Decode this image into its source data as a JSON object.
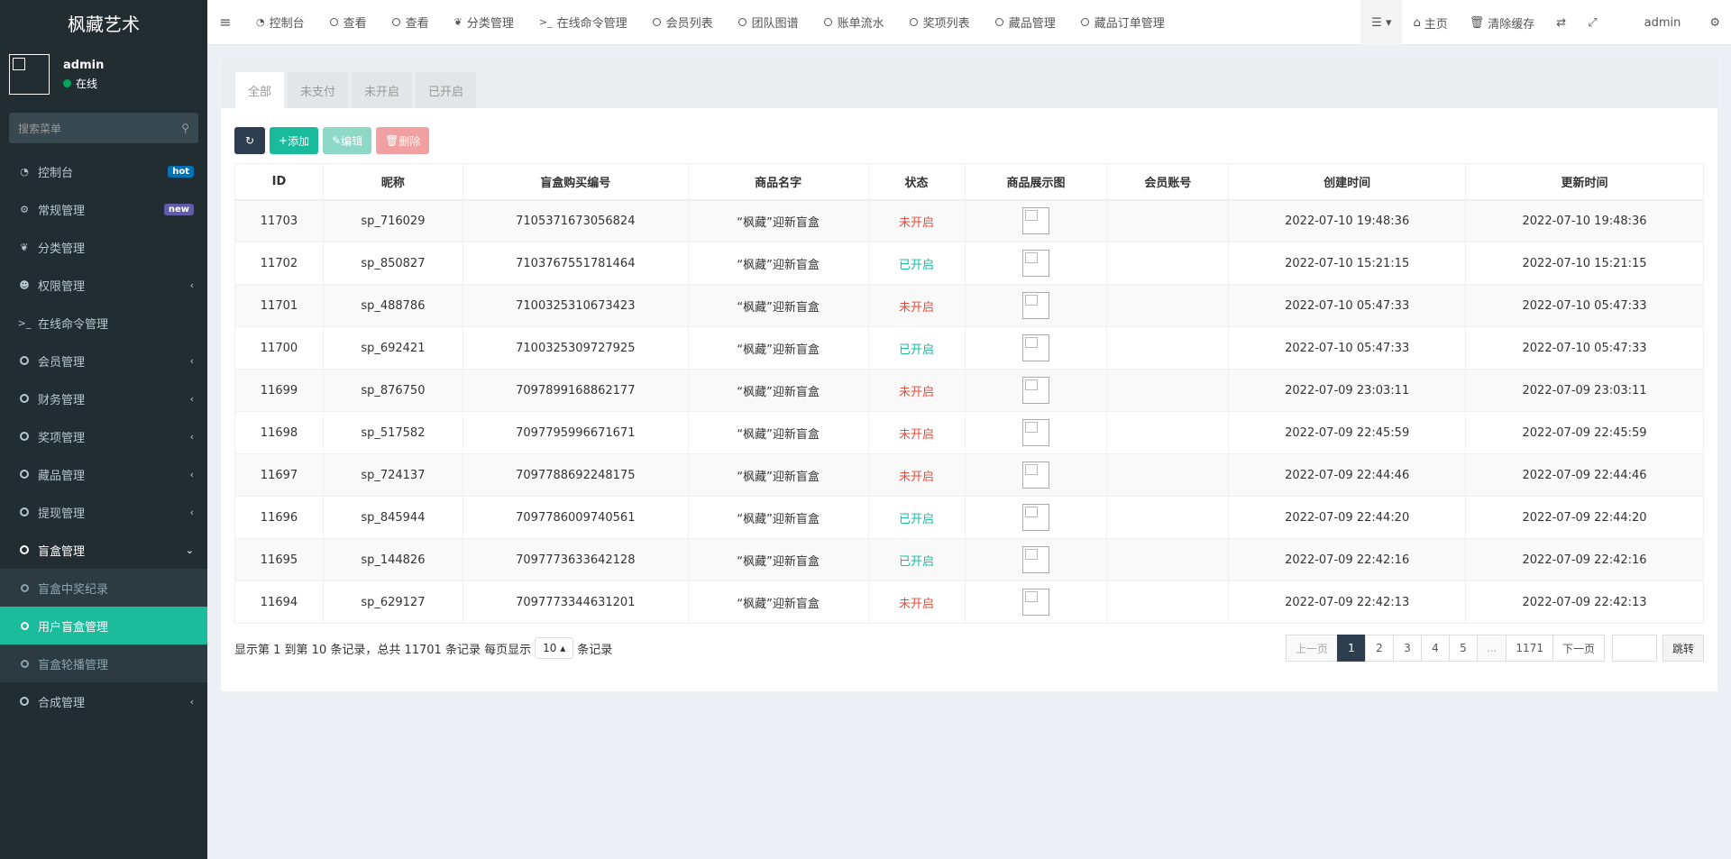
{
  "app": {
    "title": "枫藏艺术"
  },
  "user": {
    "name": "admin",
    "status": "在线"
  },
  "search": {
    "placeholder": "搜索菜单"
  },
  "sidebar": {
    "items": [
      {
        "label": "控制台",
        "badge": "hot"
      },
      {
        "label": "常规管理",
        "badge": "new"
      },
      {
        "label": "分类管理"
      },
      {
        "label": "权限管理"
      },
      {
        "label": "在线命令管理"
      },
      {
        "label": "会员管理"
      },
      {
        "label": "财务管理"
      },
      {
        "label": "奖项管理"
      },
      {
        "label": "藏品管理"
      },
      {
        "label": "提现管理"
      },
      {
        "label": "盲盒管理"
      },
      {
        "label": "合成管理"
      }
    ],
    "submenu": [
      {
        "label": "盲盒中奖纪录"
      },
      {
        "label": "用户盲盒管理"
      },
      {
        "label": "盲盒轮播管理"
      }
    ]
  },
  "topbar": {
    "tabs": [
      "控制台",
      "查看",
      "查看",
      "分类管理",
      "在线命令管理",
      "会员列表",
      "团队图谱",
      "账单流水",
      "奖项列表",
      "藏品管理",
      "藏品订单管理"
    ],
    "home": "主页",
    "clear_cache": "清除缓存",
    "admin": "admin"
  },
  "content_tabs": [
    "全部",
    "未支付",
    "未开启",
    "已开启"
  ],
  "toolbar": {
    "add": "添加",
    "edit": "编辑",
    "delete": "删除"
  },
  "table": {
    "columns": [
      "ID",
      "昵称",
      "盲盒购买编号",
      "商品名字",
      "状态",
      "商品展示图",
      "会员账号",
      "创建时间",
      "更新时间"
    ],
    "rows": [
      {
        "id": "11703",
        "nick": "sp_716029",
        "order": "7105371673056824",
        "goods": "“枫藏”迎新盲盒",
        "status": "未开启",
        "status_on": false,
        "member": "",
        "created": "2022-07-10 19:48:36",
        "updated": "2022-07-10 19:48:36"
      },
      {
        "id": "11702",
        "nick": "sp_850827",
        "order": "7103767551781464",
        "goods": "“枫藏”迎新盲盒",
        "status": "已开启",
        "status_on": true,
        "member": "",
        "created": "2022-07-10 15:21:15",
        "updated": "2022-07-10 15:21:15"
      },
      {
        "id": "11701",
        "nick": "sp_488786",
        "order": "7100325310673423",
        "goods": "“枫藏”迎新盲盒",
        "status": "未开启",
        "status_on": false,
        "member": "",
        "created": "2022-07-10 05:47:33",
        "updated": "2022-07-10 05:47:33"
      },
      {
        "id": "11700",
        "nick": "sp_692421",
        "order": "7100325309727925",
        "goods": "“枫藏”迎新盲盒",
        "status": "已开启",
        "status_on": true,
        "member": "",
        "created": "2022-07-10 05:47:33",
        "updated": "2022-07-10 05:47:33"
      },
      {
        "id": "11699",
        "nick": "sp_876750",
        "order": "7097899168862177",
        "goods": "“枫藏”迎新盲盒",
        "status": "未开启",
        "status_on": false,
        "member": "",
        "created": "2022-07-09 23:03:11",
        "updated": "2022-07-09 23:03:11"
      },
      {
        "id": "11698",
        "nick": "sp_517582",
        "order": "7097795996671671",
        "goods": "“枫藏”迎新盲盒",
        "status": "未开启",
        "status_on": false,
        "member": "",
        "created": "2022-07-09 22:45:59",
        "updated": "2022-07-09 22:45:59"
      },
      {
        "id": "11697",
        "nick": "sp_724137",
        "order": "7097788692248175",
        "goods": "“枫藏”迎新盲盒",
        "status": "未开启",
        "status_on": false,
        "member": "",
        "created": "2022-07-09 22:44:46",
        "updated": "2022-07-09 22:44:46"
      },
      {
        "id": "11696",
        "nick": "sp_845944",
        "order": "7097786009740561",
        "goods": "“枫藏”迎新盲盒",
        "status": "已开启",
        "status_on": true,
        "member": "",
        "created": "2022-07-09 22:44:20",
        "updated": "2022-07-09 22:44:20"
      },
      {
        "id": "11695",
        "nick": "sp_144826",
        "order": "7097773633642128",
        "goods": "“枫藏”迎新盲盒",
        "status": "已开启",
        "status_on": true,
        "member": "",
        "created": "2022-07-09 22:42:16",
        "updated": "2022-07-09 22:42:16"
      },
      {
        "id": "11694",
        "nick": "sp_629127",
        "order": "7097773344631201",
        "goods": "“枫藏”迎新盲盒",
        "status": "未开启",
        "status_on": false,
        "member": "",
        "created": "2022-07-09 22:42:13",
        "updated": "2022-07-09 22:42:13"
      }
    ]
  },
  "footer": {
    "summary": "显示第 1 到第 10 条记录，总共 11701 条记录 每页显示",
    "page_size": "10",
    "suffix": "条记录"
  },
  "pagination": {
    "prev": "上一页",
    "pages": [
      "1",
      "2",
      "3",
      "4",
      "5",
      "...",
      "1171"
    ],
    "next": "下一页",
    "jump": "跳转"
  },
  "colors": {
    "sidebar_bg": "#222d32",
    "accent": "#18bc9c",
    "active_page": "#2c3e50",
    "status_off": "#e74c3c"
  }
}
